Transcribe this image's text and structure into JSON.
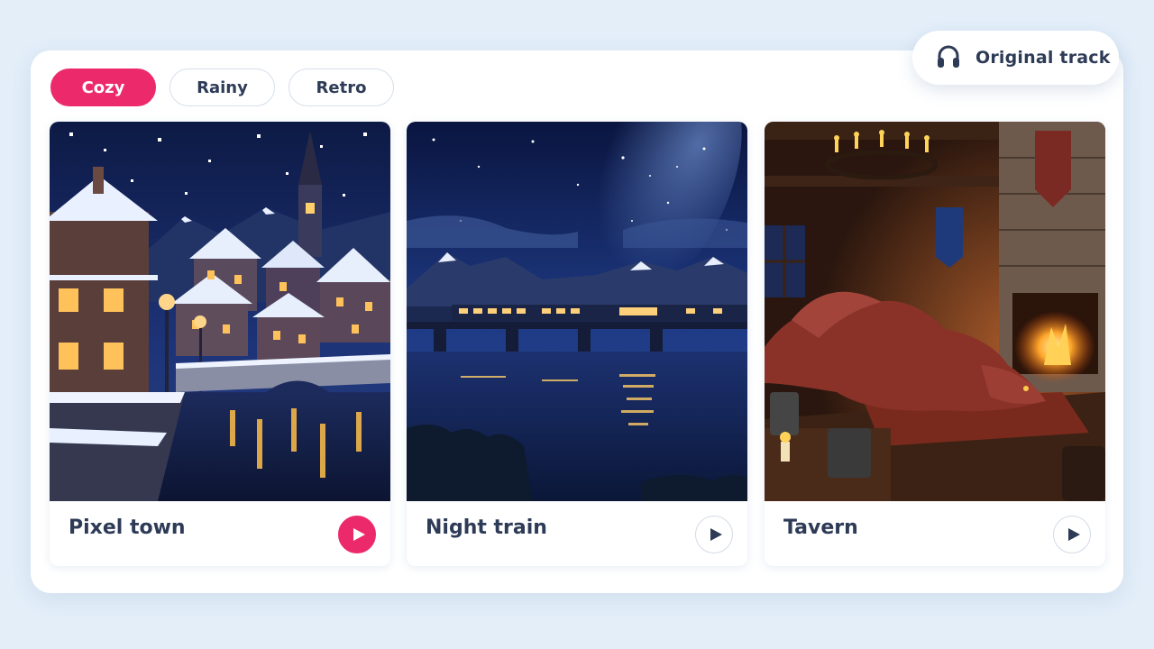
{
  "header": {
    "track_button": {
      "label": "Original track",
      "icon": "headphones-icon"
    }
  },
  "filters": [
    {
      "label": "Cozy",
      "active": true
    },
    {
      "label": "Rainy",
      "active": false
    },
    {
      "label": "Retro",
      "active": false
    }
  ],
  "cards": [
    {
      "title": "Pixel town",
      "image": "snowy pixel-art town at night",
      "playing": true
    },
    {
      "title": "Night train",
      "image": "train crossing a bridge under starry sky",
      "playing": false
    },
    {
      "title": "Tavern",
      "image": "dragon sleeping by a tavern fireplace",
      "playing": false
    }
  ],
  "colors": {
    "accent": "#ec2a6b",
    "background": "#e3eef9",
    "text": "#2e3b57"
  }
}
